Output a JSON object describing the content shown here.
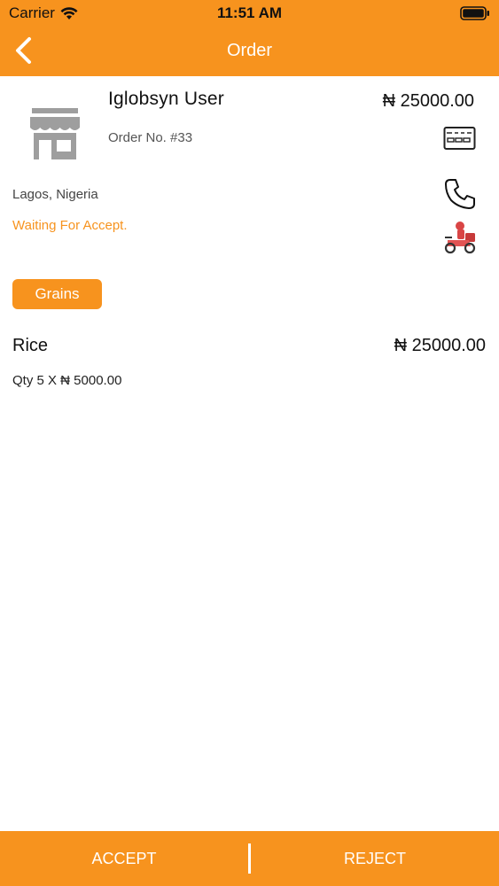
{
  "status_bar": {
    "carrier": "Carrier",
    "time": "11:51 AM"
  },
  "header": {
    "title": "Order",
    "back_icon": "chevron-left-icon"
  },
  "order": {
    "customer_name": "Iglobsyn User",
    "order_number": "Order No. #33",
    "total": "₦ 25000.00",
    "location": "Lagos, Nigeria",
    "status": "Waiting For Accept.",
    "icons": {
      "store": "store-icon",
      "payment": "card-icon",
      "phone": "phone-icon",
      "delivery": "delivery-rider-icon"
    }
  },
  "category": {
    "label": "Grains"
  },
  "items": [
    {
      "name": "Rice",
      "price": "₦ 25000.00",
      "qty_line": "Qty 5 X ₦ 5000.00"
    }
  ],
  "actions": {
    "accept_label": "ACCEPT",
    "reject_label": "REJECT"
  },
  "colors": {
    "accent": "#f7931e",
    "status_text": "#f7931e",
    "background": "#ffffff"
  }
}
